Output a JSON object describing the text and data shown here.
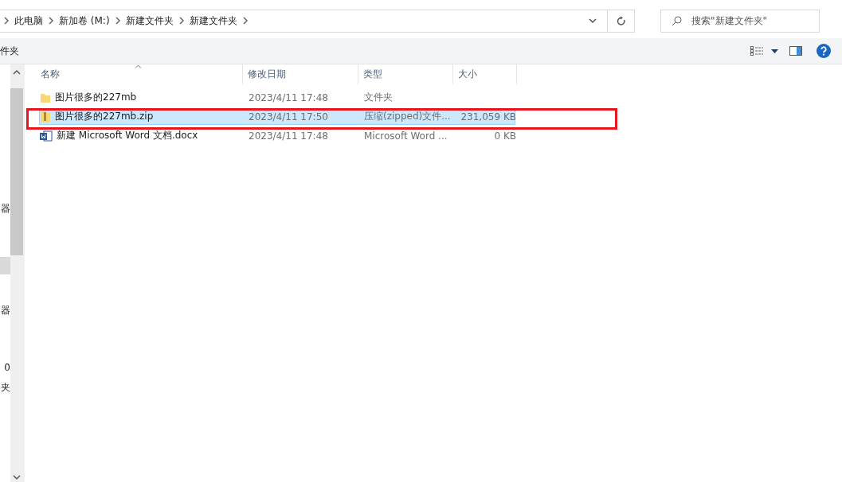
{
  "breadcrumbs": [
    "此电脑",
    "新加卷 (M:)",
    "新建文件夹",
    "新建文件夹"
  ],
  "search": {
    "placeholder": "搜索\"新建文件夹\""
  },
  "ribbon": {
    "label": "件夹"
  },
  "nav_pane": {
    "items": [
      {
        "label": "器",
        "selected": false
      },
      {
        "selected": true
      },
      {
        "label": "器",
        "selected": false
      },
      {
        "label": "0",
        "selected": false
      },
      {
        "label": "夹",
        "selected": false
      }
    ]
  },
  "table": {
    "columns": [
      "名称",
      "修改日期",
      "类型",
      "大小"
    ],
    "rows": [
      {
        "kind": "folder",
        "name": "图片很多的227mb",
        "modified": "2023/4/11 17:48",
        "type": "文件夹",
        "selected": false,
        "highlighted": false
      },
      {
        "kind": "zip",
        "name": "图片很多的227mb.zip",
        "modified": "2023/4/11 17:50",
        "type": "压缩(zipped)文件...",
        "size": "231,059 KB",
        "selected": true,
        "highlighted": true
      },
      {
        "kind": "word",
        "name": "新建 Microsoft Word 文档.docx",
        "modified": "2023/4/11 17:48",
        "type": "Microsoft Word ...",
        "size": "0 KB",
        "selected": false,
        "highlighted": false
      }
    ]
  }
}
